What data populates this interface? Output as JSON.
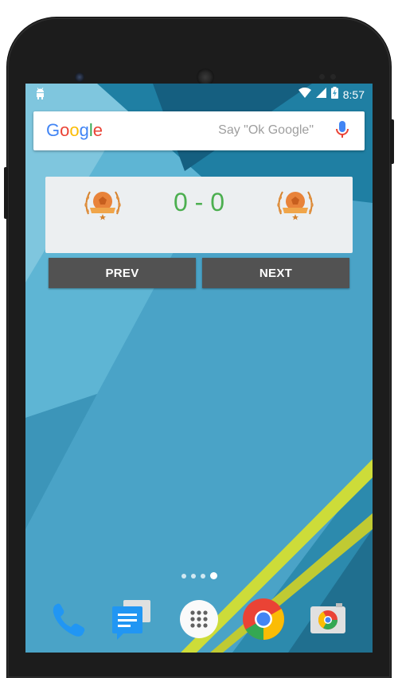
{
  "status_bar": {
    "time": "8:57",
    "left_icon": "android-debug-icon",
    "icons": [
      "wifi-icon",
      "signal-icon",
      "battery-charging-icon"
    ]
  },
  "search_bar": {
    "logo_letters": [
      {
        "char": "G",
        "color": "#4285f4"
      },
      {
        "char": "o",
        "color": "#ea4335"
      },
      {
        "char": "o",
        "color": "#fbbc05"
      },
      {
        "char": "g",
        "color": "#4285f4"
      },
      {
        "char": "l",
        "color": "#34a853"
      },
      {
        "char": "e",
        "color": "#ea4335"
      }
    ],
    "hint": "Say \"Ok Google\"",
    "mic_icon": "microphone-icon"
  },
  "score_widget": {
    "score": "0 - 0",
    "score_color": "#4caf50",
    "home_crest_icon": "football-crest-icon",
    "away_crest_icon": "football-crest-icon",
    "prev_label": "PREV",
    "next_label": "NEXT"
  },
  "home_screen": {
    "page_count": 4,
    "active_page": 4
  },
  "dock": {
    "apps": [
      "phone-app-icon",
      "messenger-app-icon",
      "app-drawer-icon",
      "chrome-app-icon",
      "camera-app-icon"
    ]
  },
  "colors": {
    "wallpaper_blue": "#4aa3c7",
    "widget_bg": "#eceff1",
    "button_bg": "#525252",
    "accent_yellow": "#cddc39"
  }
}
